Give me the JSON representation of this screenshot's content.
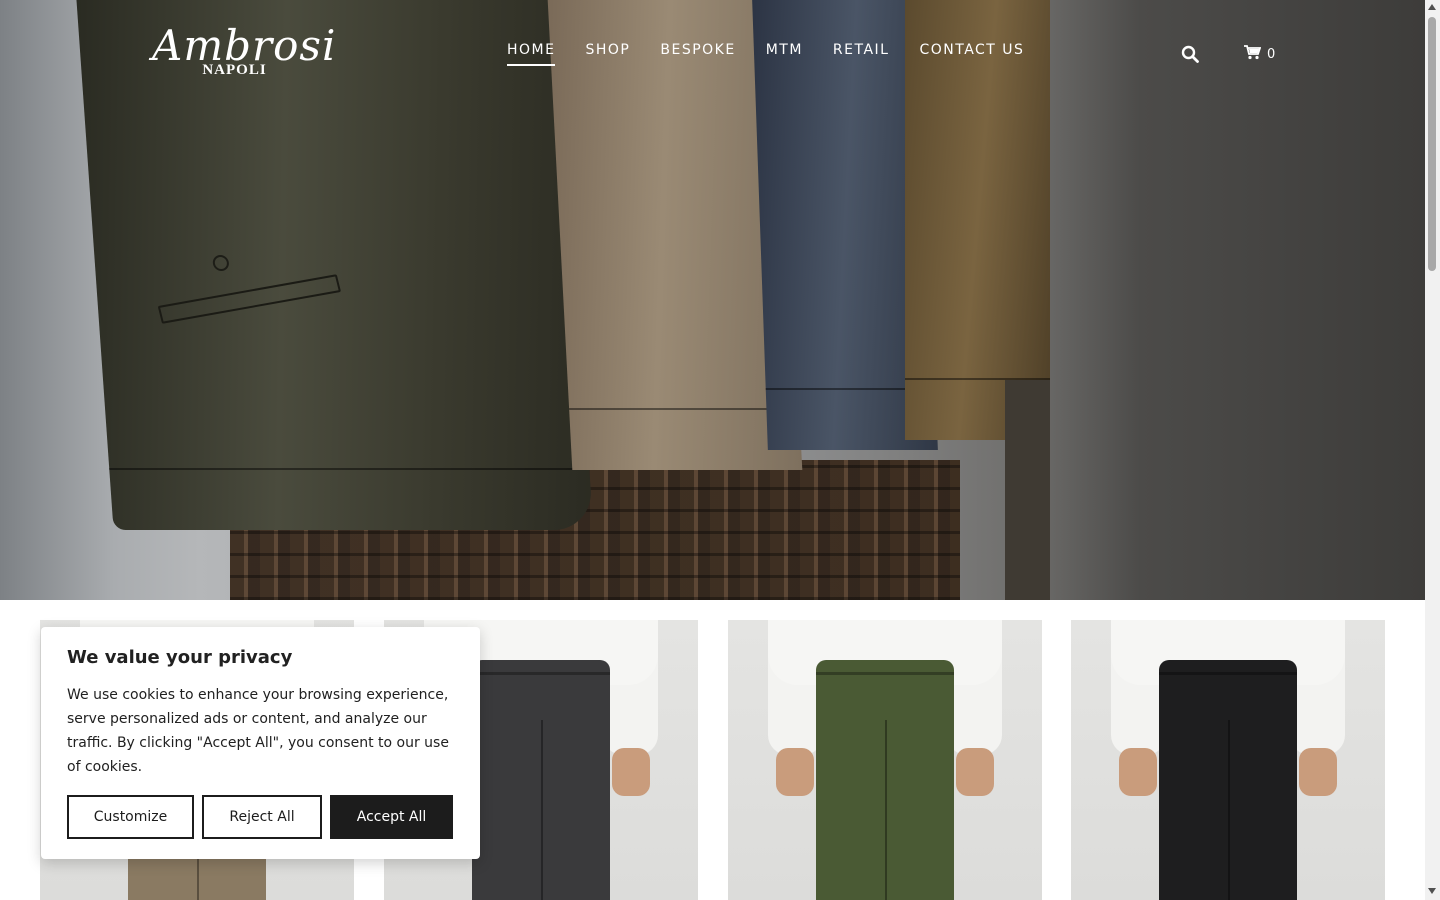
{
  "brand": {
    "name": "Ambrosi",
    "sub": "NAPOLI"
  },
  "nav": {
    "items": [
      {
        "label": "HOME",
        "active": true
      },
      {
        "label": "SHOP",
        "active": false
      },
      {
        "label": "BESPOKE",
        "active": false
      },
      {
        "label": "MTM",
        "active": false
      },
      {
        "label": "RETAIL",
        "active": false
      },
      {
        "label": "CONTACT US",
        "active": false
      }
    ]
  },
  "header": {
    "search_icon": "search-icon",
    "cart_icon": "cart-icon",
    "cart_count": "0"
  },
  "products": [
    {
      "color": "#8a7a62"
    },
    {
      "color": "#3a3a3c"
    },
    {
      "color": "#4a5a34"
    },
    {
      "color": "#1e1e1f"
    }
  ],
  "cookie": {
    "title": "We value your privacy",
    "body": "We use cookies to enhance your browsing experience, serve personalized ads or content, and analyze our traffic. By clicking \"Accept All\", you consent to our use of cookies.",
    "customize_label": "Customize",
    "reject_label": "Reject All",
    "accept_label": "Accept All"
  }
}
